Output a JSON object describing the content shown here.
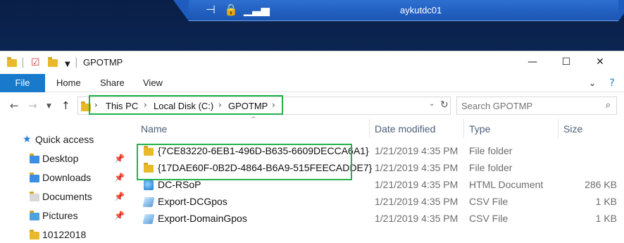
{
  "rdp": {
    "hostname": "aykutdc01"
  },
  "window": {
    "title": "GPOTMP",
    "controls": {
      "minimize": "—",
      "maximize": "☐",
      "close": "✕"
    }
  },
  "ribbon": {
    "tabs": [
      "File",
      "Home",
      "Share",
      "View"
    ]
  },
  "address": {
    "breadcrumbs": [
      "This PC",
      "Local Disk (C:)",
      "GPOTMP"
    ],
    "search_placeholder": "Search GPOTMP"
  },
  "navpane": {
    "quick_access": "Quick access",
    "items": [
      {
        "label": "Desktop",
        "pinned": true
      },
      {
        "label": "Downloads",
        "pinned": true
      },
      {
        "label": "Documents",
        "pinned": true
      },
      {
        "label": "Pictures",
        "pinned": true
      },
      {
        "label": "10122018",
        "pinned": false
      }
    ]
  },
  "filelist": {
    "columns": [
      "Name",
      "Date modified",
      "Type",
      "Size"
    ],
    "rows": [
      {
        "name": "{7CE83220-6EB1-496D-B635-6609DECCA6A1}",
        "date": "1/21/2019 4:35 PM",
        "type": "File folder",
        "size": "",
        "icon": "folder-icon"
      },
      {
        "name": "{17DAE60F-0B2D-4864-B6A9-515FEECADDE7}",
        "date": "1/21/2019 4:35 PM",
        "type": "File folder",
        "size": "",
        "icon": "folder-icon"
      },
      {
        "name": "DC-RSoP",
        "date": "1/21/2019 4:35 PM",
        "type": "HTML Document",
        "size": "286 KB",
        "icon": "html-file-icon"
      },
      {
        "name": "Export-DCGpos",
        "date": "1/21/2019 4:35 PM",
        "type": "CSV File",
        "size": "1 KB",
        "icon": "csv-file-icon"
      },
      {
        "name": "Export-DomainGpos",
        "date": "1/21/2019 4:35 PM",
        "type": "CSV File",
        "size": "1 KB",
        "icon": "csv-file-icon"
      }
    ]
  },
  "colors": {
    "accent": "#1979ca",
    "highlight": "#22b14c",
    "folder": "#e8b92a"
  }
}
